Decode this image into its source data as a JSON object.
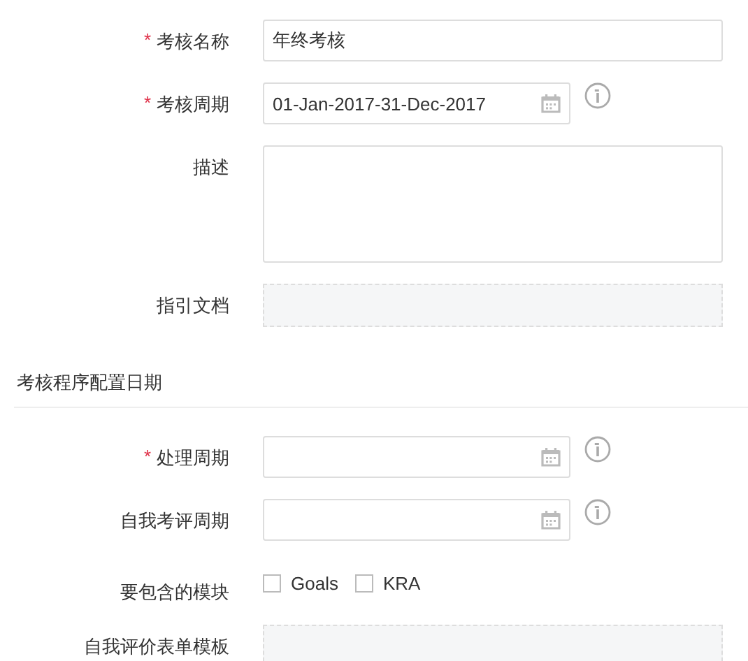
{
  "form": {
    "fields": [
      {
        "kind": "text",
        "marker": "*",
        "label": "考核名称",
        "value": "年终考核"
      },
      {
        "kind": "date",
        "marker": "*",
        "label": "考核周期",
        "value": "01-Jan-2017-31-Dec-2017",
        "info": true
      },
      {
        "kind": "textarea",
        "label": "描述"
      },
      {
        "kind": "upload",
        "label": "指引文档"
      }
    ]
  },
  "section": {
    "title": "考核程序配置日期",
    "fields": [
      {
        "kind": "date",
        "marker": "*",
        "label": "处理周期",
        "info": true
      },
      {
        "kind": "date",
        "label": "自我考评周期",
        "info": true
      },
      {
        "kind": "checkboxes",
        "label": "要包含的模块",
        "options": [
          {
            "label": "Goals",
            "checked": false
          },
          {
            "label": "KRA",
            "checked": false
          }
        ]
      },
      {
        "kind": "upload",
        "label": "自我评价表单模板"
      }
    ]
  }
}
